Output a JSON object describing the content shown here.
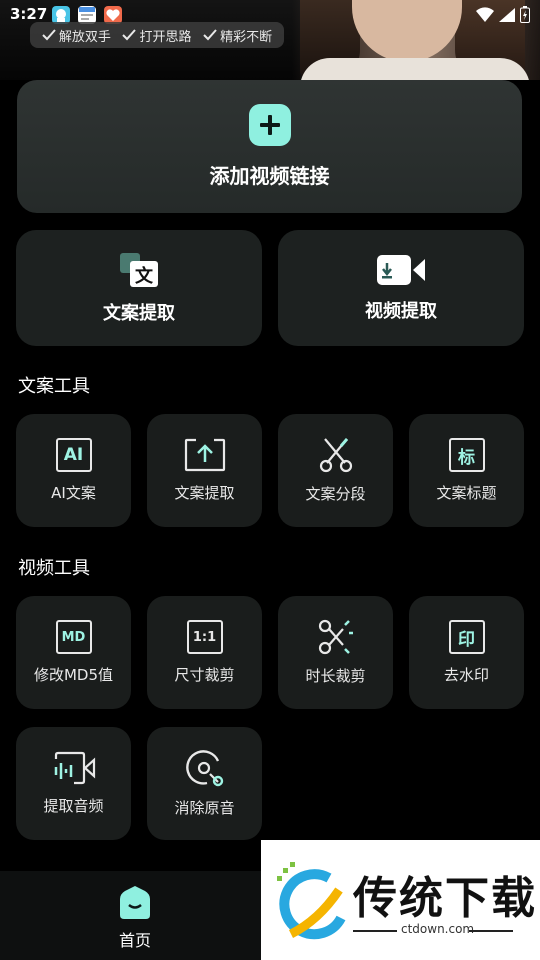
{
  "status_bar": {
    "time": "3:27"
  },
  "banner": {
    "features": [
      "解放双手",
      "打开思路",
      "精彩不断"
    ]
  },
  "main_action": {
    "label": "添加视频链接",
    "icon": "plus-icon"
  },
  "quick_actions": [
    {
      "label": "文案提取",
      "icon": "translate-text-icon"
    },
    {
      "label": "视频提取",
      "icon": "video-download-icon"
    }
  ],
  "copy_tools": {
    "title": "文案工具",
    "items": [
      {
        "label": "AI文案",
        "icon_text": "AI"
      },
      {
        "label": "文案提取",
        "icon": "upload-box-icon"
      },
      {
        "label": "文案分段",
        "icon": "scissors-icon"
      },
      {
        "label": "文案标题",
        "icon_text": "标"
      }
    ]
  },
  "video_tools": {
    "title": "视频工具",
    "items": [
      {
        "label": "修改MD5值",
        "icon_text": "MD"
      },
      {
        "label": "尺寸裁剪",
        "icon_text": "1:1"
      },
      {
        "label": "时长裁剪",
        "icon": "scissors-clock-icon"
      },
      {
        "label": "去水印",
        "icon_text": "印"
      },
      {
        "label": "提取音频",
        "icon": "audio-video-icon"
      },
      {
        "label": "消除原音",
        "icon": "mute-audio-icon"
      }
    ]
  },
  "bottom_nav": {
    "home_label": "首页"
  },
  "watermark": {
    "text": "传统下载",
    "url": "ctdown.com"
  },
  "colors": {
    "accent": "#8ff0e0",
    "background": "#000000",
    "card": "#1a1d1c"
  }
}
